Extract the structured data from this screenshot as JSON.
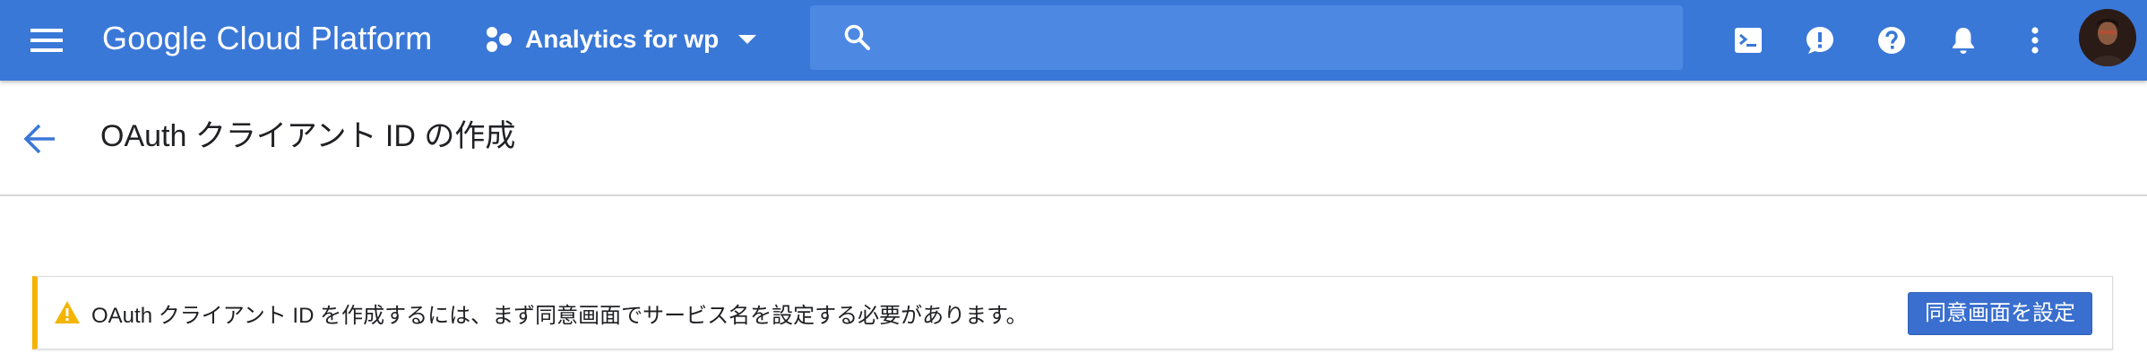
{
  "topbar": {
    "brand": "Google Cloud Platform",
    "project_name": "Analytics for wp",
    "search": {
      "value": "",
      "placeholder": ""
    },
    "icons": [
      "menu-icon",
      "project-icon",
      "chevron-down-icon",
      "search-icon",
      "cloud-shell-icon",
      "feedback-icon",
      "help-icon",
      "notifications-icon",
      "more-vert-icon",
      "avatar"
    ],
    "colors": {
      "bar": "#3a78d8",
      "search_bg": "#4d88e3"
    }
  },
  "page": {
    "title": "OAuth クライアント ID の作成",
    "back_icon": "arrow-back-icon"
  },
  "banner": {
    "message": "OAuth クライアント ID を作成するには、まず同意画面でサービス名を設定する必要があります。",
    "action_label": "同意画面を設定",
    "icon": "warning-icon",
    "colors": {
      "accent": "#f4b400",
      "button": "#3a6fcf"
    }
  }
}
